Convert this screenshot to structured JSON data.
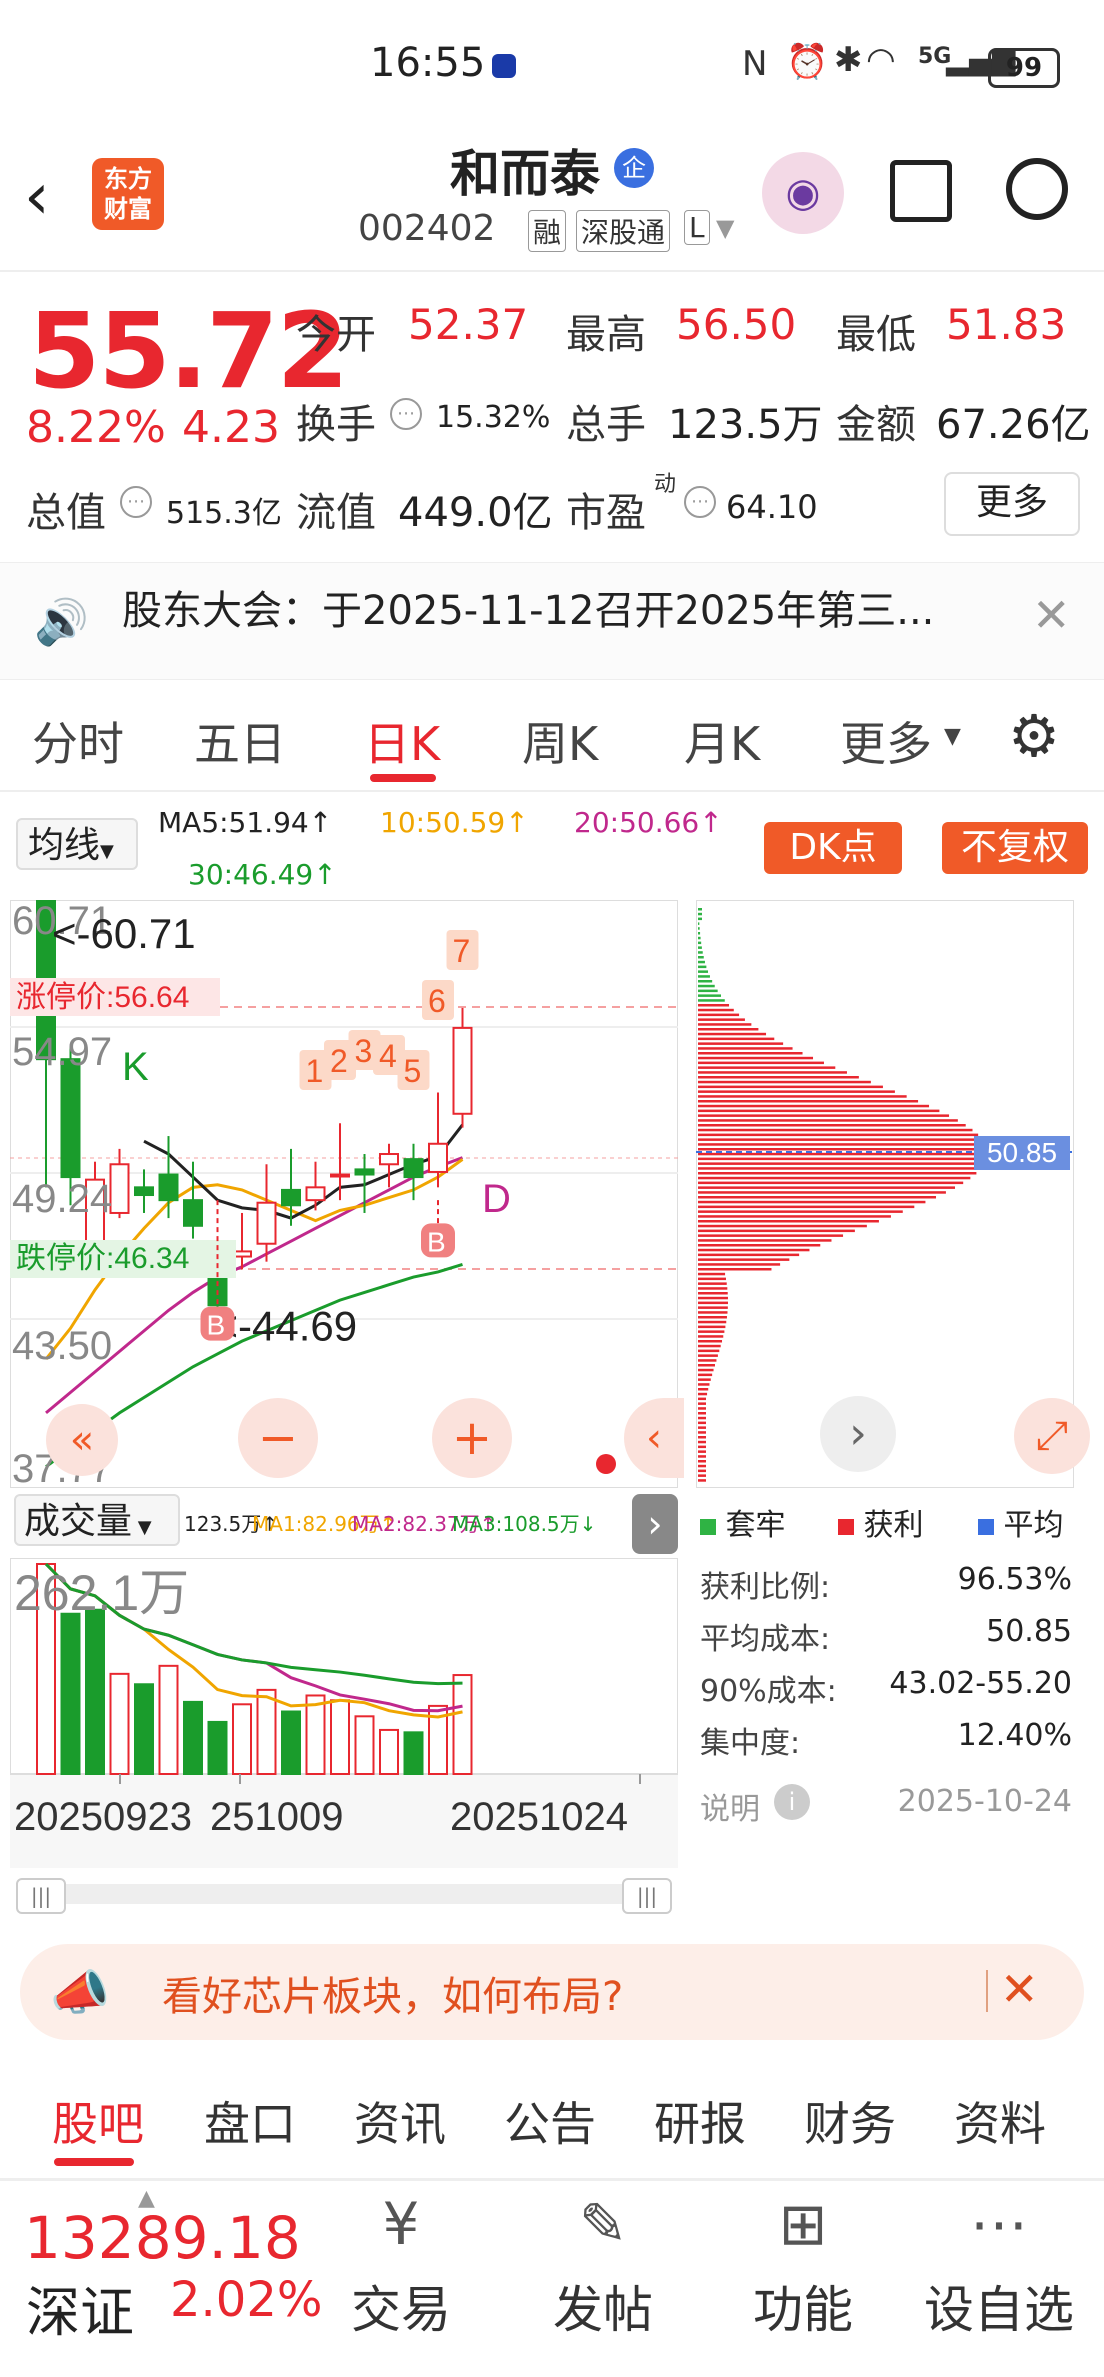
{
  "status_bar": {
    "time": "16:55",
    "signal": "5G",
    "battery": "99"
  },
  "header": {
    "stock_name": "和而泰",
    "stock_code": "002402",
    "badge": "企",
    "tags": [
      "融",
      "深股通",
      "L"
    ],
    "logo_text_1": "东方",
    "logo_text_2": "财富"
  },
  "quote": {
    "price": "55.72",
    "change_pct": "8.22%",
    "change_amt": "4.23",
    "open_label": "今开",
    "open": "52.37",
    "high_label": "最高",
    "high": "56.50",
    "low_label": "最低",
    "low": "51.83",
    "turnover_label": "换手",
    "turnover": "15.32%",
    "volume_label": "总手",
    "volume": "123.5万",
    "amount_label": "金额",
    "amount": "67.26亿",
    "mktcap_label": "总值",
    "mktcap": "515.3亿",
    "float_label": "流值",
    "float_cap": "449.0亿",
    "pe_label": "市盈",
    "pe_sup": "动",
    "pe": "64.10",
    "more": "更多"
  },
  "notice": {
    "text": "股东大会：于2025-11-12召开2025年第三..."
  },
  "chart_tabs": [
    "分时",
    "五日",
    "日K",
    "周K",
    "月K",
    "更多"
  ],
  "active_tab_index": 2,
  "chart_header": {
    "ma_select": "均线",
    "ma5": "MA5:51.94↑",
    "ma10": "10:50.59↑",
    "ma20": "20:50.66↑",
    "ma30": "30:46.49↑",
    "dk_button": "DK点",
    "fq_button": "不复权"
  },
  "price_axis": [
    "60.71",
    "54.97",
    "49.24",
    "43.50",
    "37.77"
  ],
  "annotations": {
    "high_mark": "<-60.71",
    "low_mark": "<-44.69",
    "limit_up": "涨停价:56.64",
    "limit_down": "跌停价:46.34",
    "k_label": "K",
    "d_label": "D",
    "b_label": "B",
    "nums": [
      "1",
      "2",
      "3",
      "4",
      "5",
      "6",
      "7"
    ]
  },
  "volume_header": {
    "select": "成交量",
    "vol": "123.5万↑",
    "ma1": "MA1:82.96万↑",
    "ma2": "MA2:82.37万↑",
    "ma3": "MA3:108.5万↓",
    "max": "262.1万"
  },
  "date_axis": [
    "20250923",
    "251009",
    "20251024"
  ],
  "chip": {
    "avg_label": "50.85",
    "legend": [
      "套牢",
      "获利",
      "平均"
    ],
    "rows": [
      {
        "k": "获利比例:",
        "v": "96.53%"
      },
      {
        "k": "平均成本:",
        "v": "50.85"
      },
      {
        "k": "90%成本:",
        "v": "43.02-55.20"
      },
      {
        "k": "集中度:",
        "v": "12.40%"
      }
    ],
    "explain": "说明",
    "date": "2025-10-24"
  },
  "promo": {
    "text": "看好芯片板块，如何布局?"
  },
  "bottom_tabs": [
    "股吧",
    "盘口",
    "资讯",
    "公告",
    "研报",
    "财务",
    "资料"
  ],
  "footer": {
    "index_value": "13289.18",
    "index_name": "深证",
    "index_change": "2.02%",
    "items": [
      "交易",
      "发帖",
      "功能",
      "设自选"
    ]
  },
  "chart_data": {
    "type": "candlestick",
    "ylim": [
      37.77,
      60.71
    ],
    "x": [
      "20250923",
      "251009",
      "20251024"
    ],
    "candles": [
      {
        "o": 60.71,
        "c": 54.5,
        "h": 60.71,
        "l": 49.5
      },
      {
        "o": 54.5,
        "c": 49.9,
        "h": 55.0,
        "l": 48.8
      },
      {
        "o": 47.0,
        "c": 49.8,
        "h": 50.5,
        "l": 46.5
      },
      {
        "o": 48.5,
        "c": 50.4,
        "h": 51.0,
        "l": 48.3
      },
      {
        "o": 49.5,
        "c": 49.2,
        "h": 50.2,
        "l": 48.5
      },
      {
        "o": 50.0,
        "c": 49.0,
        "h": 51.5,
        "l": 48.3
      },
      {
        "o": 49.0,
        "c": 48.0,
        "h": 50.5,
        "l": 47.5
      },
      {
        "o": 46.9,
        "c": 44.9,
        "h": 47.5,
        "l": 44.69
      },
      {
        "o": 46.8,
        "c": 47.0,
        "h": 48.5,
        "l": 46.3
      },
      {
        "o": 47.3,
        "c": 48.9,
        "h": 50.4,
        "l": 46.6
      },
      {
        "o": 49.4,
        "c": 48.8,
        "h": 51.0,
        "l": 48.0
      },
      {
        "o": 49.0,
        "c": 49.5,
        "h": 50.5,
        "l": 48.6
      },
      {
        "o": 50.0,
        "c": 50.0,
        "h": 52.0,
        "l": 49.0
      },
      {
        "o": 50.2,
        "c": 50.0,
        "h": 50.8,
        "l": 48.5
      },
      {
        "o": 50.4,
        "c": 50.8,
        "h": 51.2,
        "l": 49.5
      },
      {
        "o": 50.6,
        "c": 49.9,
        "h": 51.2,
        "l": 49.0
      },
      {
        "o": 50.1,
        "c": 51.2,
        "h": 53.2,
        "l": 49.5
      },
      {
        "o": 52.37,
        "c": 55.72,
        "h": 56.5,
        "l": 51.83
      }
    ],
    "volume": [
      262.1,
      200,
      205,
      125,
      112,
      135,
      90,
      65,
      87,
      105,
      78,
      98,
      92,
      72,
      55,
      52,
      85,
      123.5
    ],
    "volume_colors": [
      "up",
      "down",
      "down",
      "up",
      "down",
      "up",
      "down",
      "down",
      "up",
      "up",
      "down",
      "up",
      "up",
      "up",
      "up",
      "down",
      "up",
      "up"
    ],
    "ma5": [
      null,
      null,
      null,
      null,
      51.3,
      50.8,
      49.9,
      49.0,
      48.7,
      48.6,
      48.3,
      48.8,
      49.5,
      49.6,
      50.0,
      50.4,
      50.7,
      51.94
    ],
    "ma10": [
      42.8,
      44.0,
      45.5,
      46.8,
      47.9,
      48.9,
      49.5,
      49.6,
      49.4,
      49.0,
      48.6,
      48.2,
      48.6,
      48.8,
      49.1,
      49.4,
      49.9,
      50.59
    ],
    "ma20": [
      40.7,
      41.5,
      42.3,
      43.1,
      43.9,
      44.7,
      45.4,
      46.0,
      46.4,
      46.9,
      47.4,
      47.9,
      48.4,
      48.9,
      49.4,
      49.9,
      50.3,
      50.66
    ],
    "ma30": [
      38.6,
      39.3,
      40.0,
      40.7,
      41.3,
      41.9,
      42.5,
      43.0,
      43.5,
      43.9,
      44.3,
      44.7,
      45.1,
      45.4,
      45.7,
      46.0,
      46.2,
      46.49
    ]
  }
}
